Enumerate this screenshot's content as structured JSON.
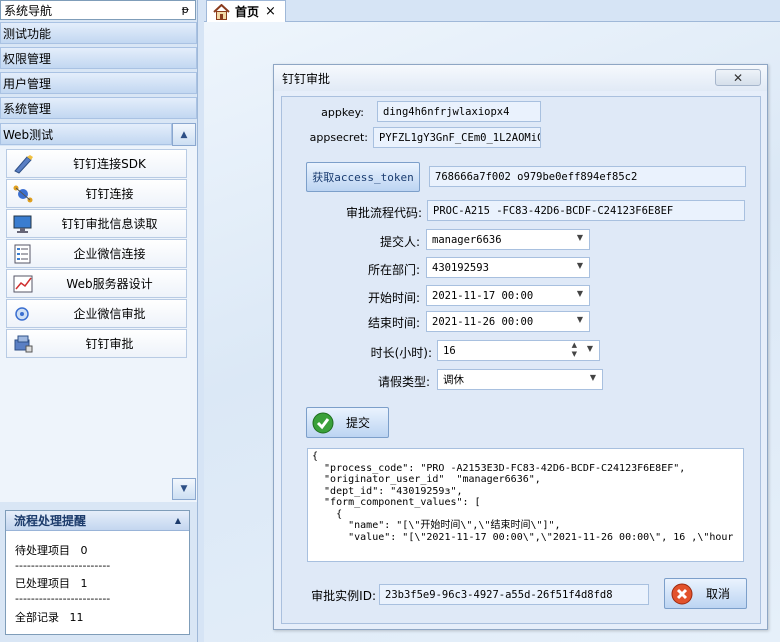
{
  "nav": {
    "title": "系统导航",
    "pin": "ᵽ",
    "categories": [
      "测试功能",
      "权限管理",
      "用户管理",
      "系统管理",
      "Web测试"
    ],
    "collapse": "▲",
    "scroll_down": "▼",
    "items": [
      {
        "label": "钉钉连接SDK",
        "icon": "pencil-icon"
      },
      {
        "label": "钉钉连接",
        "icon": "network-icon"
      },
      {
        "label": "钉钉审批信息读取",
        "icon": "monitor-icon"
      },
      {
        "label": "企业微信连接",
        "icon": "list-icon"
      },
      {
        "label": "Web服务器设计",
        "icon": "chart-icon"
      },
      {
        "label": "企业微信审批",
        "icon": "disc-icon"
      },
      {
        "label": "钉钉审批",
        "icon": "approve-icon"
      }
    ]
  },
  "flow": {
    "title": "流程处理提醒",
    "pending_label": "待处理项目",
    "pending_count": "0",
    "done_label": "已处理项目",
    "done_count": "1",
    "all_label": "全部记录",
    "all_count": "11",
    "separator": "------------------------"
  },
  "tabs": {
    "home_label": "首页",
    "close": "×"
  },
  "dialog": {
    "title": "钉钉审批",
    "close": "✕",
    "appkey_label": "appkey:",
    "appkey_value": "ding4h6nfrjwlaxiopx4",
    "appsecret_label": "appsecret:",
    "appsecret_value": "PYFZL1gY3GnF_CEm0_1L2AOMiC",
    "token_button": "获取access_token",
    "token_value": "768666a7f002 o979be0eff894ef85c2",
    "process_code_label": "审批流程代码:",
    "process_code_value": "PROC-A215 -FC83-42D6-BCDF-C24123F6E8EF",
    "submitter_label": "提交人:",
    "submitter_value": "manager6636",
    "dept_label": "所在部门:",
    "dept_value": "430192593",
    "start_label": "开始时间:",
    "start_value": "2021-11-17 00:00",
    "end_label": "结束时间:",
    "end_value": "2021-11-26 00:00",
    "duration_label": "时长(小时):",
    "duration_value": "16",
    "leave_type_label": "请假类型:",
    "leave_type_value": "调休",
    "submit_button": "提交",
    "json_text": "{\n  \"process_code\": \"PRO -A2153E3D-FC83-42D6-BCDF-C24123F6E8EF\",\n  \"originator_user_id\"  \"manager6636\",\n  \"dept_id\": \"43019259ɜ\",\n  \"form_component_values\": [\n    {\n      \"name\": \"[\\\"开始时间\\\",\\\"结束时间\\\"]\",\n      \"value\": \"[\\\"2021-11-17 00:00\\\",\\\"2021-11-26 00:00\\\", 16 ,\\\"hour",
    "instance_label": "审批实例ID:",
    "instance_value": "23b3f5e9-96c3-4927-a55d-26f51f4d8fd8",
    "cancel_button": "取消"
  },
  "colors": {
    "accent": "#bcd4f2",
    "ok_green": "#3aa03a",
    "cancel_red": "#e2522c"
  }
}
